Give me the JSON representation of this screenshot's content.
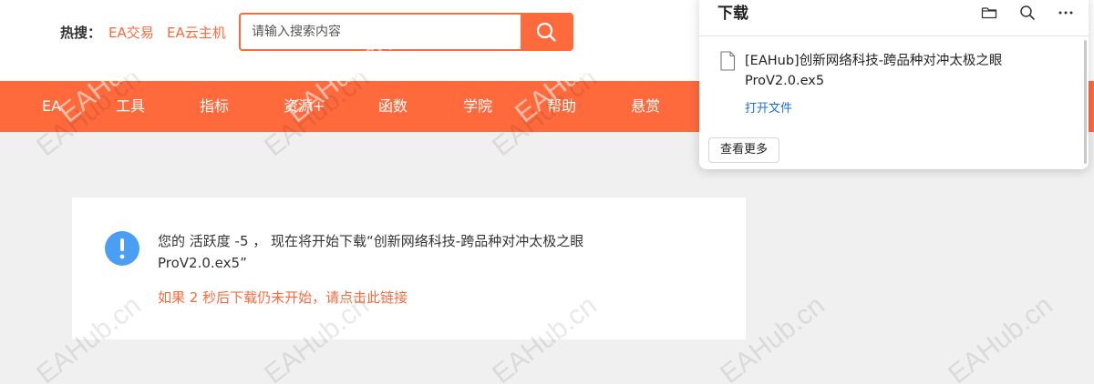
{
  "header": {
    "hot_label": "热搜：",
    "hot_links": [
      "EA交易",
      "EA云主机"
    ],
    "search_placeholder": "请输入搜索内容"
  },
  "nav": {
    "items": [
      "EA",
      "工具",
      "指标",
      "资源+",
      "函数",
      "学院",
      "帮助",
      "悬赏"
    ]
  },
  "notice": {
    "text": "您的 活跃度 -5 ， 现在将开始下载“创新网络科技-跨品种对冲太极之眼ProV2.0.ex5”",
    "link": "如果 2 秒后下载仍未开始，请点击此链接"
  },
  "download_panel": {
    "title": "下载",
    "file_name": "[EAHub]创新网络科技-跨品种对冲太极之眼ProV2.0.ex5",
    "open_label": "打开文件",
    "more_label": "查看更多"
  },
  "watermark": "EAHub.cn",
  "colors": {
    "brand": "#ff6a3d",
    "info_icon": "#4a9ff5",
    "link_blue": "#1a6fd8"
  },
  "icons": [
    "search-icon",
    "info-icon",
    "folder-icon",
    "search-icon",
    "more-icon",
    "file-icon"
  ]
}
